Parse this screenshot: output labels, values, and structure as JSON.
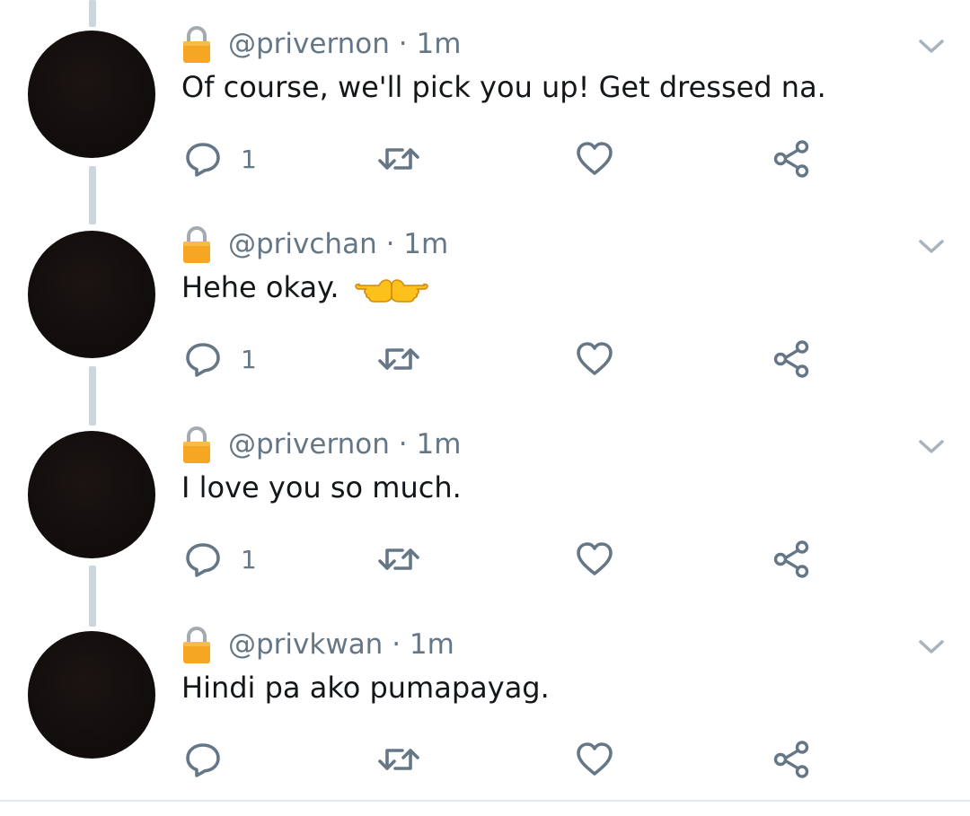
{
  "tweets": [
    {
      "handle": "@privernon",
      "time": "1m",
      "text": "Of course, we'll pick you up! Get dressed na.",
      "emoji": "",
      "reply_count": "1"
    },
    {
      "handle": "@privchan",
      "time": "1m",
      "text": "Hehe okay.",
      "emoji": "👉👈",
      "reply_count": "1"
    },
    {
      "handle": "@privernon",
      "time": "1m",
      "text": "I love you so much.",
      "emoji": "",
      "reply_count": "1"
    },
    {
      "handle": "@privkwan",
      "time": "1m",
      "text": "Hindi pa ako pumapayag.",
      "emoji": "",
      "reply_count": ""
    }
  ],
  "separator": " · ",
  "icons": {
    "lock": "lock-icon",
    "more": "chevron-down-icon",
    "reply": "reply-icon",
    "retweet": "retweet-icon",
    "like": "heart-icon",
    "share": "share-icon"
  },
  "colors": {
    "text": "#14171a",
    "secondary": "#657786",
    "thread_line": "#ccd6dd",
    "lock_body": "#f5a623",
    "lock_shackle": "#a5aab0"
  }
}
